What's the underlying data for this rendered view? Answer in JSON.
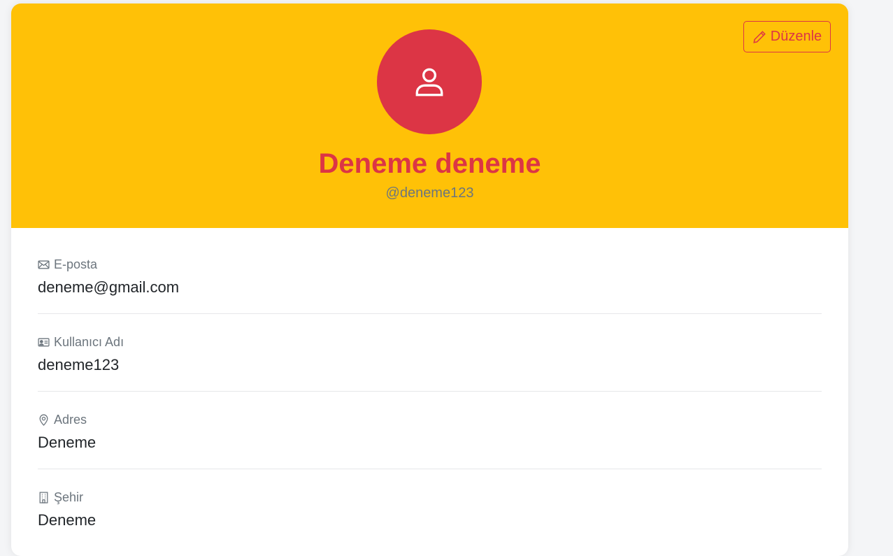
{
  "profile": {
    "edit_label": "Düzenle",
    "name": "Deneme deneme",
    "handle": "@deneme123"
  },
  "fields": [
    {
      "label": "E-posta",
      "value": "deneme@gmail.com",
      "icon": "envelope-icon"
    },
    {
      "label": "Kullanıcı Adı",
      "value": "deneme123",
      "icon": "id-card-icon"
    },
    {
      "label": "Adres",
      "value": "Deneme",
      "icon": "location-pin-icon"
    },
    {
      "label": "Şehir",
      "value": "Deneme",
      "icon": "building-icon"
    }
  ],
  "colors": {
    "header": "#ffc107",
    "accent": "#dc3545",
    "muted": "#6c757d",
    "text": "#212529"
  }
}
